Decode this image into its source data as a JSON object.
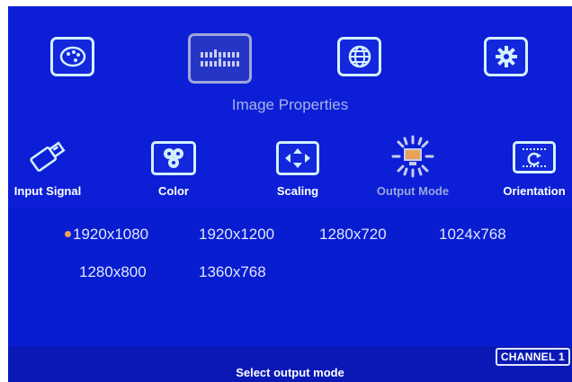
{
  "menu": {
    "top_title": "Image Properties",
    "top_icons": [
      "palette-icon",
      "image-properties-icon",
      "globe-icon",
      "gear-icon"
    ],
    "sub_items": [
      {
        "label": "Input Signal",
        "icon": "usb-plug-icon"
      },
      {
        "label": "Color",
        "icon": "color-dots-icon"
      },
      {
        "label": "Scaling",
        "icon": "scaling-arrows-icon"
      },
      {
        "label": "Output Mode",
        "icon": "monitor-burst-icon"
      },
      {
        "label": "Orientation",
        "icon": "rotate-icon"
      }
    ]
  },
  "options": {
    "selected": "1920x1080",
    "items": [
      "1920x1080",
      "1920x1200",
      "1280x720",
      "1024x768",
      "1280x800",
      "1360x768"
    ]
  },
  "status": {
    "text": "Select output mode",
    "channel": "CHANNEL 1"
  },
  "colors": {
    "background": "#0c1fd6",
    "highlight": "#e8a25a",
    "selected_label": "#9aa4dc"
  }
}
